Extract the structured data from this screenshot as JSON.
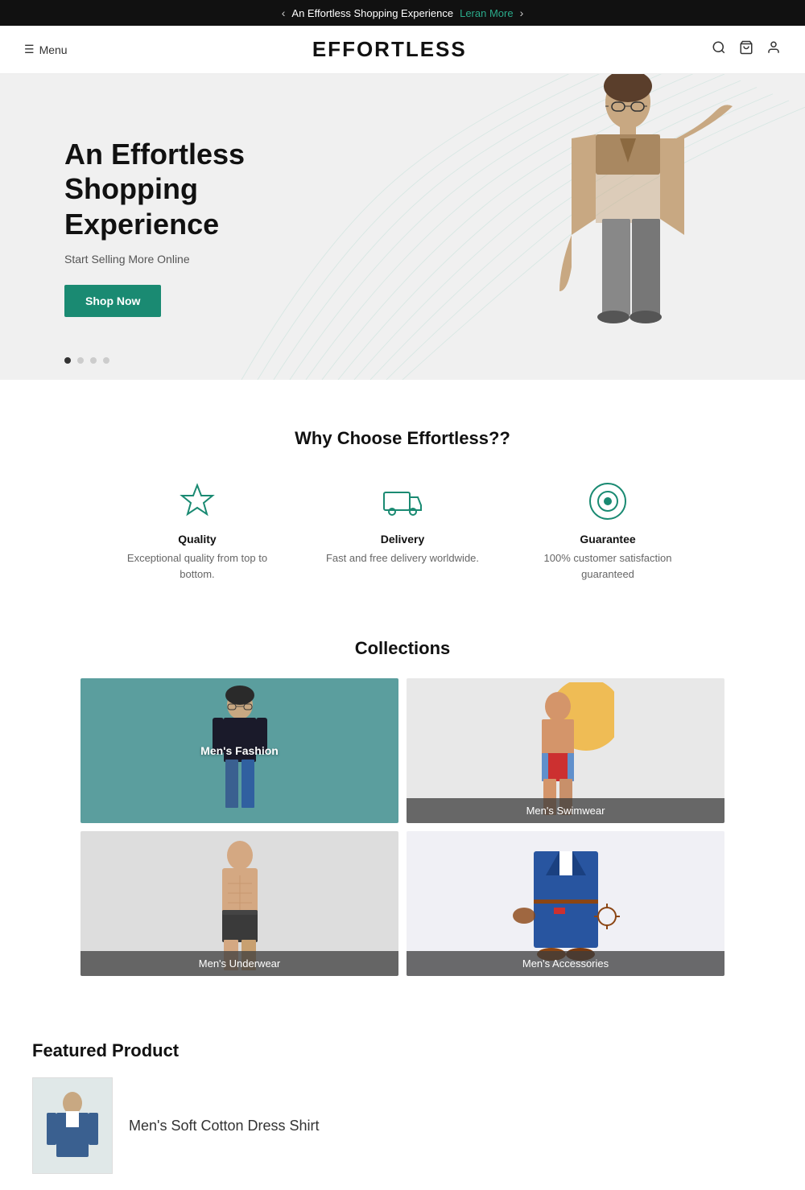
{
  "announcement": {
    "text": "An Effortless Shopping Experience",
    "link_text": "Leran More",
    "prev_arrow": "‹",
    "next_arrow": "›"
  },
  "header": {
    "menu_label": "Menu",
    "logo": "EFFORTLESS"
  },
  "hero": {
    "title_line1": "An Effortless",
    "title_line2": "Shopping Experience",
    "subtitle": "Start Selling More Online",
    "cta_button": "Shop Now",
    "dots": [
      true,
      false,
      false,
      false
    ]
  },
  "why_choose": {
    "title": "Why Choose Effortless??",
    "features": [
      {
        "id": "quality",
        "icon": "star",
        "title": "Quality",
        "desc": "Exceptional quality from top to bottom."
      },
      {
        "id": "delivery",
        "icon": "truck",
        "title": "Delivery",
        "desc": "Fast and free delivery worldwide."
      },
      {
        "id": "guarantee",
        "icon": "badge",
        "title": "Guarantee",
        "desc": "100% customer satisfaction guaranteed"
      }
    ]
  },
  "collections": {
    "title": "Collections",
    "items": [
      {
        "id": "mens-fashion",
        "label": "Men's Fashion",
        "bg": "teal",
        "center_label": true
      },
      {
        "id": "mens-swimwear",
        "label": "Men's Swimwear",
        "bg": "light-gray",
        "center_label": false
      },
      {
        "id": "mens-underwear",
        "label": "Men's Underwear",
        "bg": "gray",
        "center_label": false
      },
      {
        "id": "mens-accessories",
        "label": "Men's Accessories",
        "bg": "white",
        "center_label": false
      }
    ]
  },
  "featured": {
    "title": "Featured Product",
    "product_name": "Men's Soft Cotton Dress Shirt"
  }
}
